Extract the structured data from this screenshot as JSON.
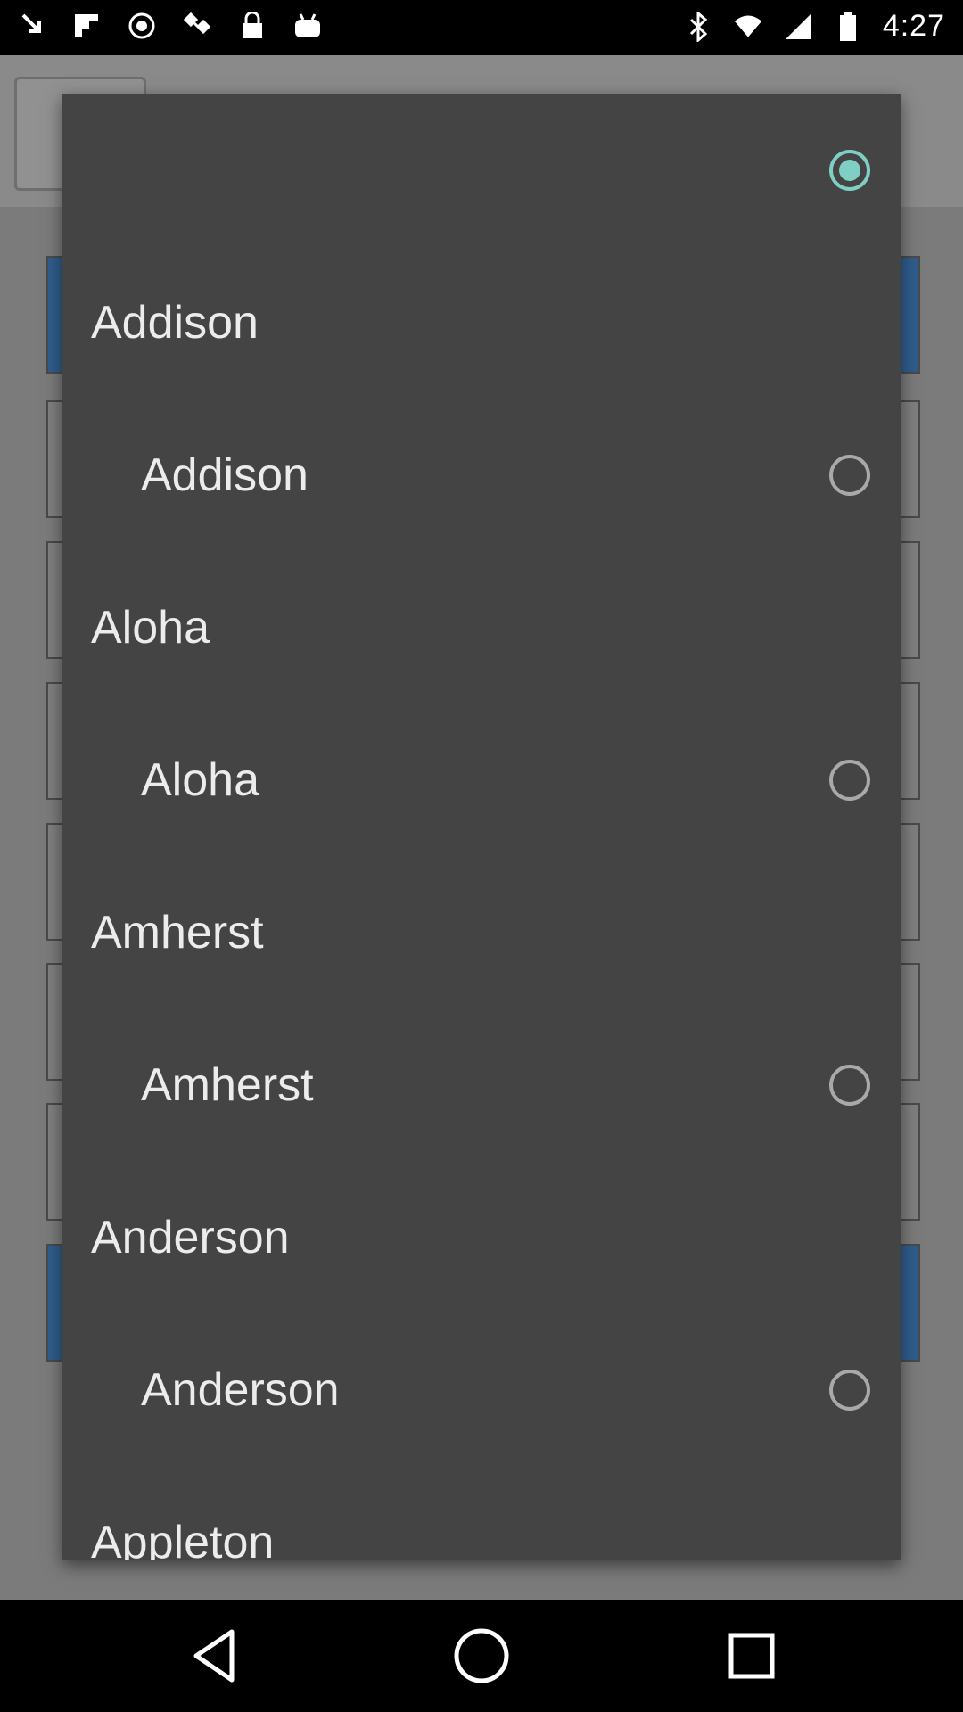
{
  "status_bar": {
    "time": "4:27",
    "left_icons": [
      "download-arrow-icon",
      "flipboard-icon",
      "circle-dot-icon",
      "satellite-icon",
      "lock-icon",
      "android-icon"
    ],
    "right_icons": [
      "bluetooth-icon",
      "wifi-icon",
      "signal-icon",
      "battery-icon"
    ]
  },
  "dialog": {
    "rows": [
      {
        "type": "option",
        "label": "",
        "checked": true
      },
      {
        "type": "header",
        "label": "Addison"
      },
      {
        "type": "option",
        "label": "Addison",
        "checked": false
      },
      {
        "type": "header",
        "label": "Aloha"
      },
      {
        "type": "option",
        "label": "Aloha",
        "checked": false
      },
      {
        "type": "header",
        "label": "Amherst"
      },
      {
        "type": "option",
        "label": "Amherst",
        "checked": false
      },
      {
        "type": "header",
        "label": "Anderson"
      },
      {
        "type": "option",
        "label": "Anderson",
        "checked": false
      },
      {
        "type": "header",
        "label": "Appleton"
      }
    ]
  },
  "colors": {
    "dialog_bg": "#444444",
    "accent": "#7fcfc5"
  },
  "nav_bar": {
    "buttons": [
      "back-icon",
      "home-icon",
      "recents-icon"
    ]
  }
}
